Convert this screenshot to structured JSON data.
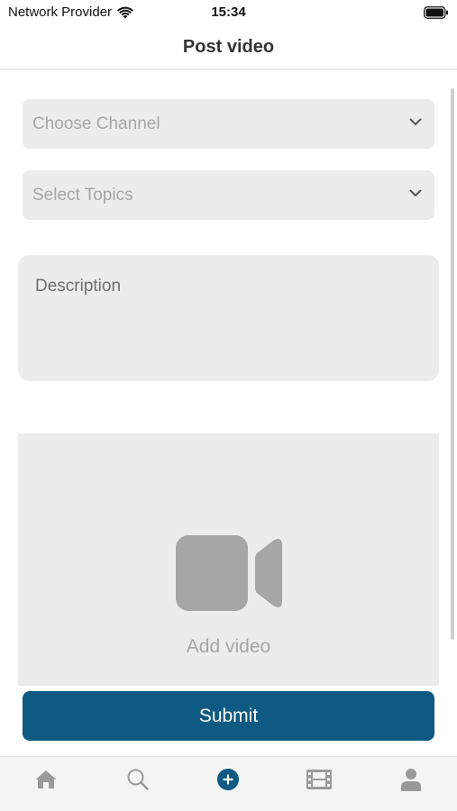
{
  "status_bar": {
    "carrier": "Network Provider",
    "time": "15:34"
  },
  "nav": {
    "title": "Post video"
  },
  "form": {
    "channel_placeholder": "Choose Channel",
    "topics_placeholder": "Select Topics",
    "description_placeholder": "Description",
    "add_video_label": "Add video",
    "submit_label": "Submit"
  },
  "tab_bar": {
    "items": [
      {
        "icon": "home-icon",
        "active": false
      },
      {
        "icon": "search-icon",
        "active": false
      },
      {
        "icon": "add-circle-icon",
        "active": true
      },
      {
        "icon": "film-icon",
        "active": false
      },
      {
        "icon": "profile-icon",
        "active": false
      }
    ]
  },
  "colors": {
    "accent": "#0f5a82",
    "field_background": "#ececec",
    "placeholder_text": "#a6a6a6",
    "inactive_tab_icon": "#9a9a9a"
  }
}
